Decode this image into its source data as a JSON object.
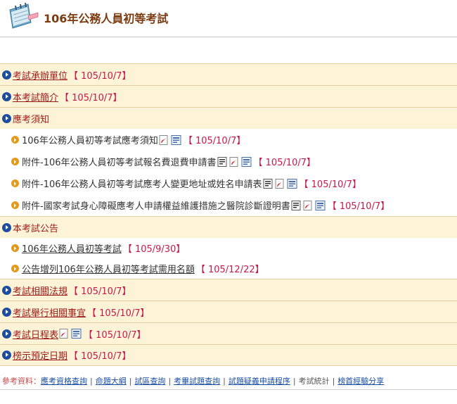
{
  "header": {
    "title": "106年公務人員初等考試"
  },
  "sections": [
    {
      "title": "考試承辦單位",
      "date": "【 105/10/7】",
      "link": true
    },
    {
      "title": "本考試簡介",
      "date": "【 105/10/7】",
      "link": true
    },
    {
      "title": "應考須知",
      "date": "",
      "link": false,
      "items": [
        {
          "text": "106年公務人員初等考試應考須知",
          "date": "【 105/10/7】",
          "icons": [
            "pdf-icon",
            "odt-icon"
          ]
        },
        {
          "text": "附件-106年公務人員初等考試報名費退費申請書",
          "date": "【 105/10/7】",
          "icons": [
            "doc-icon",
            "pdf-icon",
            "odt-icon"
          ]
        },
        {
          "text": "附件-106年公務人員初等考試應考人變更地址或姓名申請表",
          "date": "【 105/10/7】",
          "icons": [
            "doc-icon",
            "pdf-icon",
            "odt-icon"
          ]
        },
        {
          "text": "附件-國家考試身心障礙應考人申請權益維護措施之醫院診斷證明書",
          "date": "【 105/10/7】",
          "icons": [
            "doc-icon",
            "pdf-icon",
            "odt-icon"
          ]
        }
      ]
    },
    {
      "title": "本考試公告",
      "date": "",
      "link": false,
      "items": [
        {
          "text": "106年公務人員初等考試",
          "date": "【 105/9/30】",
          "link": true,
          "icons": []
        },
        {
          "text": "公告增列106年公務人員初等考試需用名額",
          "date": "【 105/12/22】",
          "link": true,
          "icons": []
        }
      ]
    },
    {
      "title": "考試相關法規",
      "date": "【 105/10/7】",
      "link": true
    },
    {
      "title": "考試舉行相關事宜",
      "date": "【 105/10/7】",
      "link": true
    },
    {
      "title": "考試日程表",
      "date": "【 105/10/7】",
      "link": true,
      "icons": [
        "pdf-icon",
        "odt-icon"
      ]
    },
    {
      "title": "榜示預定日期",
      "date": "【 105/10/7】",
      "link": true
    }
  ],
  "footer": {
    "label": "參考資料：",
    "links": [
      "應考資格查詢",
      "命題大綱",
      "試區查詢",
      "考畢試題查詢",
      "試題疑義申請程序",
      "考試統計",
      "榜首經驗分享"
    ]
  }
}
